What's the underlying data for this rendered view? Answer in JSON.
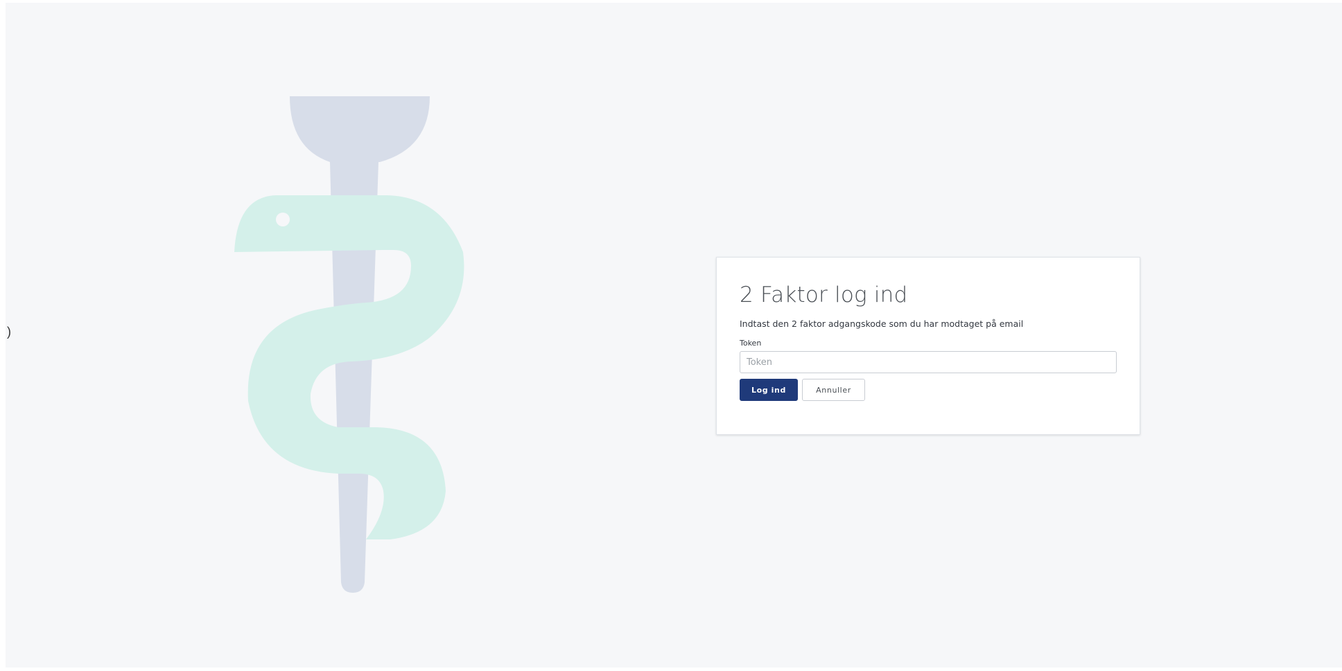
{
  "edge_mark": ")",
  "login_card": {
    "title": "2 Faktor log ind",
    "description": "Indtast den 2 faktor adgangskode som du har modtaget på email",
    "token_label": "Token",
    "token_placeholder": "Token",
    "token_value": "",
    "submit_label": "Log ind",
    "cancel_label": "Annuller"
  },
  "illustration": {
    "icon": "rod-of-asclepius-icon",
    "staff_color": "#d7dde9",
    "snake_color": "#d4f0ea"
  },
  "colors": {
    "primary": "#1f3a7a",
    "background": "#f6f7f9"
  }
}
